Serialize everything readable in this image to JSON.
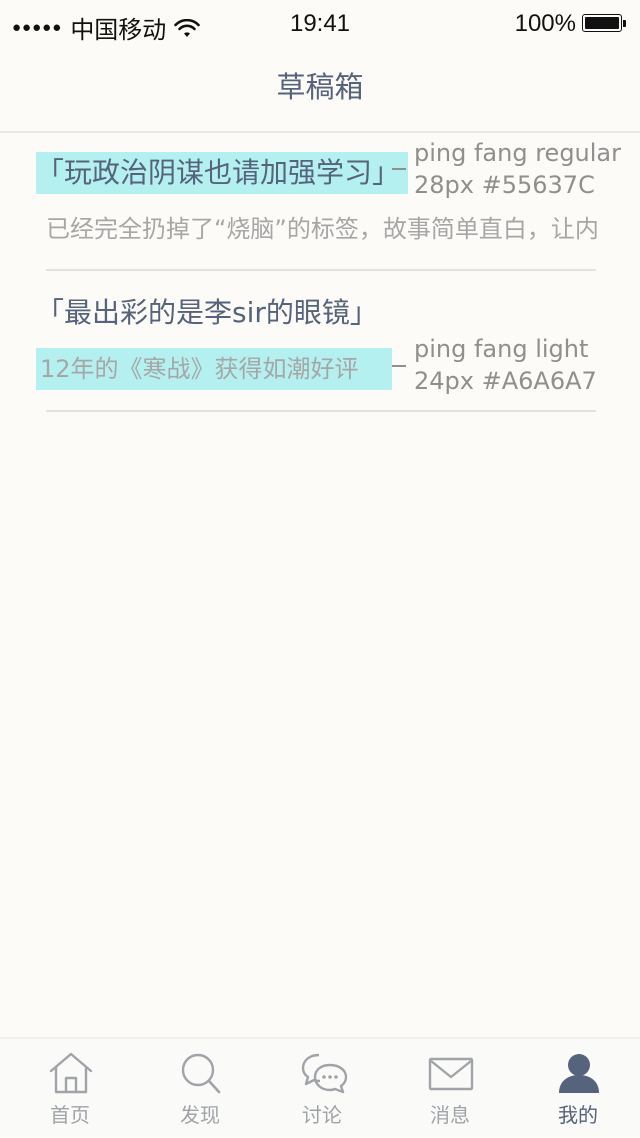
{
  "status_bar": {
    "signal": "●●●●●",
    "carrier": "中国移动",
    "time": "19:41",
    "battery": "100%"
  },
  "nav": {
    "title": "草稿箱"
  },
  "drafts": [
    {
      "title": "「玩政治阴谋也请加强学习」",
      "desc": "已经完全扔掉了“烧脑”的标签，故事简单直白，让内"
    },
    {
      "title": "「最出彩的是李sir的眼镜」",
      "desc": "12年的《寒战》获得如潮好评"
    }
  ],
  "annotations": {
    "title_spec": {
      "line1": "ping fang regular",
      "line2": "28px #55637C"
    },
    "desc_spec": {
      "line1": "ping fang light",
      "line2": "24px #A6A6A7"
    }
  },
  "tabs": [
    {
      "label": "首页",
      "icon": "home-icon"
    },
    {
      "label": "发现",
      "icon": "search-icon"
    },
    {
      "label": "讨论",
      "icon": "chat-icon"
    },
    {
      "label": "消息",
      "icon": "mail-icon"
    },
    {
      "label": "我的",
      "icon": "profile-icon",
      "active": true
    }
  ],
  "colors": {
    "title": "#55637C",
    "desc": "#A6A6A7",
    "highlight": "#B5F0F0",
    "background": "#FCFBF7"
  }
}
